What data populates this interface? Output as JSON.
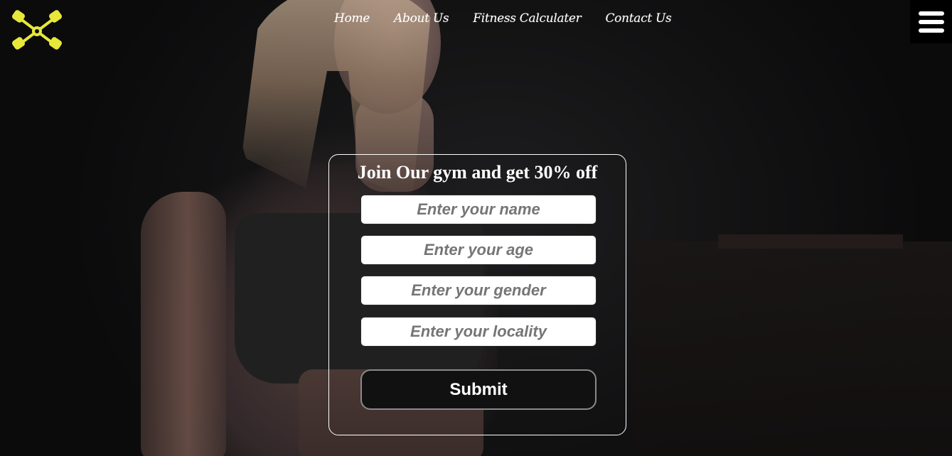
{
  "nav": {
    "items": [
      {
        "label": "Home"
      },
      {
        "label": "About Us"
      },
      {
        "label": "Fitness Calculater"
      },
      {
        "label": "Contact Us"
      }
    ]
  },
  "logo": {
    "icon": "crossed-dumbbells-icon",
    "color": "#e7e83a"
  },
  "menu": {
    "icon": "hamburger-menu-icon"
  },
  "form": {
    "title": "Join Our gym and get 30% off",
    "fields": [
      {
        "placeholder": "Enter your name",
        "value": ""
      },
      {
        "placeholder": "Enter your age",
        "value": ""
      },
      {
        "placeholder": "Enter your gender",
        "value": ""
      },
      {
        "placeholder": "Enter your locality",
        "value": ""
      }
    ],
    "submit_label": "Submit"
  }
}
